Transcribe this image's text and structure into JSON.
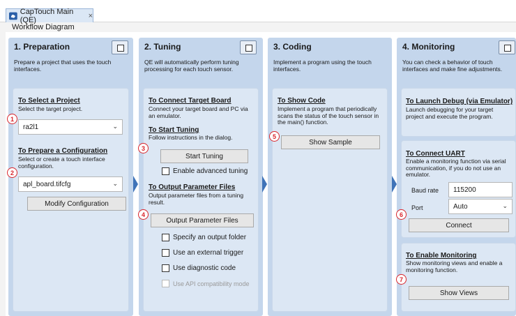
{
  "tab": {
    "title": "CapTouch Main (QE)",
    "close": "×"
  },
  "subtitle": "Workflow Diagram",
  "columns": {
    "c1": {
      "title": "1. Preparation",
      "desc": "Prepare a project that uses the touch interfaces."
    },
    "c2": {
      "title": "2. Tuning",
      "desc": "QE will automatically perform tuning processing for each touch sensor."
    },
    "c3": {
      "title": "3. Coding",
      "desc": "Implement a program using the touch interfaces."
    },
    "c4": {
      "title": "4. Monitoring",
      "desc": "You can check a behavior of touch interfaces and make fine adjustments."
    }
  },
  "prep": {
    "select_title": "To Select a Project",
    "select_desc": "Select the target project.",
    "project_value": "ra2l1",
    "config_title": "To Prepare a Configuration",
    "config_desc": "Select or create a touch interface configuration.",
    "config_value": "apl_board.tifcfg",
    "modify_label": "Modify Configuration"
  },
  "tuning": {
    "connect_title": "To Connect Target Board",
    "connect_desc": "Connect your target board and PC via an emulator.",
    "start_title": "To Start Tuning",
    "start_desc": "Follow instructions in the dialog.",
    "start_btn": "Start Tuning",
    "advanced": "Enable advanced tuning",
    "output_title": "To Output Parameter Files",
    "output_desc": "Output parameter files from a tuning result.",
    "output_btn": "Output Parameter Files",
    "opt1": "Specify an output folder",
    "opt2": "Use an external trigger",
    "opt3": "Use diagnostic code",
    "opt4": "Use API compatibility mode"
  },
  "coding": {
    "show_title": "To Show Code",
    "show_desc": "Implement a program that periodically scans the status of the touch sensor in the main() function.",
    "show_btn": "Show Sample"
  },
  "monitoring": {
    "debug_title": "To Launch Debug (via Emulator)",
    "debug_desc": "Launch debugging for your target project and execute the program.",
    "uart_title": "To Connect UART",
    "uart_desc": "Enable a monitoring function via serial communication, if you do not use an emulator.",
    "baud_label": "Baud rate",
    "baud_value": "115200",
    "port_label": "Port",
    "port_value": "Auto",
    "connect_btn": "Connect",
    "enable_title": "To Enable Monitoring",
    "enable_desc": "Show monitoring views and enable a monitoring function.",
    "views_btn": "Show Views"
  },
  "steps": [
    "1",
    "2",
    "3",
    "4",
    "5",
    "6",
    "7"
  ],
  "colors": {
    "accent": "#3f73b8",
    "step": "#d9262c",
    "panel": "#c4d6ec"
  }
}
